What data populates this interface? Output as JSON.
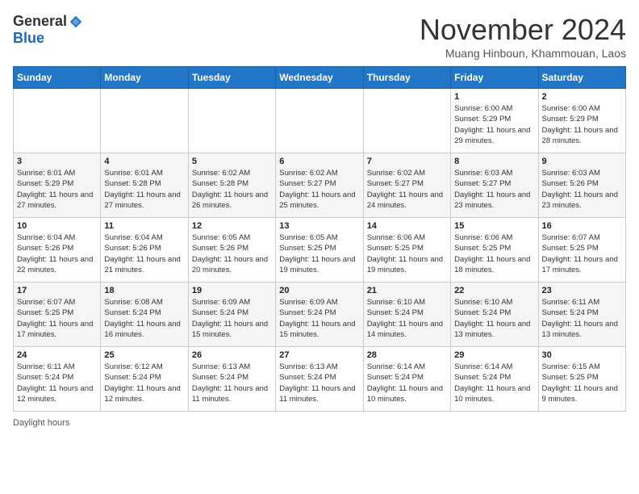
{
  "logo": {
    "general": "General",
    "blue": "Blue"
  },
  "title": "November 2024",
  "subtitle": "Muang Hinboun, Khammouan, Laos",
  "days_of_week": [
    "Sunday",
    "Monday",
    "Tuesday",
    "Wednesday",
    "Thursday",
    "Friday",
    "Saturday"
  ],
  "weeks": [
    [
      {
        "day": "",
        "info": ""
      },
      {
        "day": "",
        "info": ""
      },
      {
        "day": "",
        "info": ""
      },
      {
        "day": "",
        "info": ""
      },
      {
        "day": "",
        "info": ""
      },
      {
        "day": "1",
        "info": "Sunrise: 6:00 AM\nSunset: 5:29 PM\nDaylight: 11 hours and 29 minutes."
      },
      {
        "day": "2",
        "info": "Sunrise: 6:00 AM\nSunset: 5:29 PM\nDaylight: 11 hours and 28 minutes."
      }
    ],
    [
      {
        "day": "3",
        "info": "Sunrise: 6:01 AM\nSunset: 5:29 PM\nDaylight: 11 hours and 27 minutes."
      },
      {
        "day": "4",
        "info": "Sunrise: 6:01 AM\nSunset: 5:28 PM\nDaylight: 11 hours and 27 minutes."
      },
      {
        "day": "5",
        "info": "Sunrise: 6:02 AM\nSunset: 5:28 PM\nDaylight: 11 hours and 26 minutes."
      },
      {
        "day": "6",
        "info": "Sunrise: 6:02 AM\nSunset: 5:27 PM\nDaylight: 11 hours and 25 minutes."
      },
      {
        "day": "7",
        "info": "Sunrise: 6:02 AM\nSunset: 5:27 PM\nDaylight: 11 hours and 24 minutes."
      },
      {
        "day": "8",
        "info": "Sunrise: 6:03 AM\nSunset: 5:27 PM\nDaylight: 11 hours and 23 minutes."
      },
      {
        "day": "9",
        "info": "Sunrise: 6:03 AM\nSunset: 5:26 PM\nDaylight: 11 hours and 23 minutes."
      }
    ],
    [
      {
        "day": "10",
        "info": "Sunrise: 6:04 AM\nSunset: 5:26 PM\nDaylight: 11 hours and 22 minutes."
      },
      {
        "day": "11",
        "info": "Sunrise: 6:04 AM\nSunset: 5:26 PM\nDaylight: 11 hours and 21 minutes."
      },
      {
        "day": "12",
        "info": "Sunrise: 6:05 AM\nSunset: 5:26 PM\nDaylight: 11 hours and 20 minutes."
      },
      {
        "day": "13",
        "info": "Sunrise: 6:05 AM\nSunset: 5:25 PM\nDaylight: 11 hours and 19 minutes."
      },
      {
        "day": "14",
        "info": "Sunrise: 6:06 AM\nSunset: 5:25 PM\nDaylight: 11 hours and 19 minutes."
      },
      {
        "day": "15",
        "info": "Sunrise: 6:06 AM\nSunset: 5:25 PM\nDaylight: 11 hours and 18 minutes."
      },
      {
        "day": "16",
        "info": "Sunrise: 6:07 AM\nSunset: 5:25 PM\nDaylight: 11 hours and 17 minutes."
      }
    ],
    [
      {
        "day": "17",
        "info": "Sunrise: 6:07 AM\nSunset: 5:25 PM\nDaylight: 11 hours and 17 minutes."
      },
      {
        "day": "18",
        "info": "Sunrise: 6:08 AM\nSunset: 5:24 PM\nDaylight: 11 hours and 16 minutes."
      },
      {
        "day": "19",
        "info": "Sunrise: 6:09 AM\nSunset: 5:24 PM\nDaylight: 11 hours and 15 minutes."
      },
      {
        "day": "20",
        "info": "Sunrise: 6:09 AM\nSunset: 5:24 PM\nDaylight: 11 hours and 15 minutes."
      },
      {
        "day": "21",
        "info": "Sunrise: 6:10 AM\nSunset: 5:24 PM\nDaylight: 11 hours and 14 minutes."
      },
      {
        "day": "22",
        "info": "Sunrise: 6:10 AM\nSunset: 5:24 PM\nDaylight: 11 hours and 13 minutes."
      },
      {
        "day": "23",
        "info": "Sunrise: 6:11 AM\nSunset: 5:24 PM\nDaylight: 11 hours and 13 minutes."
      }
    ],
    [
      {
        "day": "24",
        "info": "Sunrise: 6:11 AM\nSunset: 5:24 PM\nDaylight: 11 hours and 12 minutes."
      },
      {
        "day": "25",
        "info": "Sunrise: 6:12 AM\nSunset: 5:24 PM\nDaylight: 11 hours and 12 minutes."
      },
      {
        "day": "26",
        "info": "Sunrise: 6:13 AM\nSunset: 5:24 PM\nDaylight: 11 hours and 11 minutes."
      },
      {
        "day": "27",
        "info": "Sunrise: 6:13 AM\nSunset: 5:24 PM\nDaylight: 11 hours and 11 minutes."
      },
      {
        "day": "28",
        "info": "Sunrise: 6:14 AM\nSunset: 5:24 PM\nDaylight: 11 hours and 10 minutes."
      },
      {
        "day": "29",
        "info": "Sunrise: 6:14 AM\nSunset: 5:24 PM\nDaylight: 11 hours and 10 minutes."
      },
      {
        "day": "30",
        "info": "Sunrise: 6:15 AM\nSunset: 5:25 PM\nDaylight: 11 hours and 9 minutes."
      }
    ]
  ],
  "footer": "Daylight hours"
}
